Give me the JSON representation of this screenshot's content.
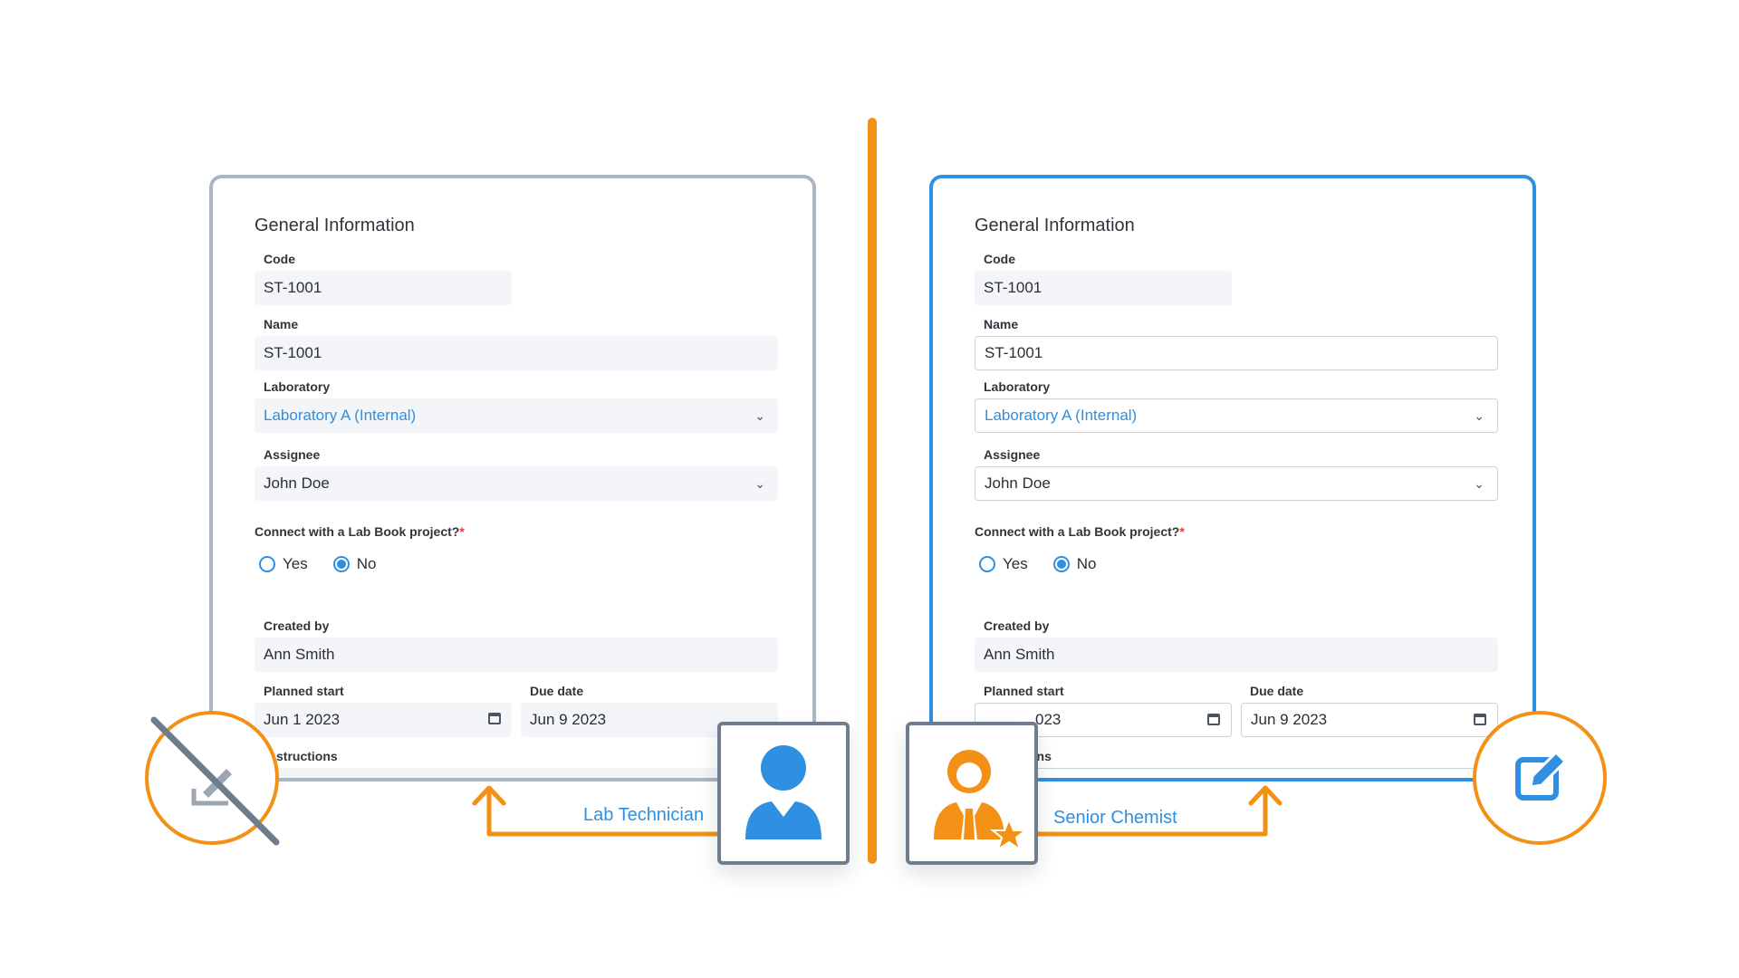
{
  "colors": {
    "accent_orange": "#f29115",
    "accent_blue": "#2f8fe0",
    "readonly_border": "#aab6c2",
    "icon_gray": "#6d7d8d"
  },
  "left_panel": {
    "role": "Lab Technician",
    "mode_icon": "edit-disabled-icon",
    "title": "General Information",
    "code_label": "Code",
    "code_value": "ST-1001",
    "name_label": "Name",
    "name_value": "ST-1001",
    "lab_label": "Laboratory",
    "lab_value": "Laboratory A (Internal)",
    "assignee_label": "Assignee",
    "assignee_value": "John Doe",
    "connect_label": "Connect with a Lab Book project?",
    "required_mark": "*",
    "yes_label": "Yes",
    "no_label": "No",
    "selected_option": "No",
    "created_label": "Created by",
    "created_value": "Ann Smith",
    "start_label": "Planned start",
    "start_value": "Jun 1 2023",
    "due_label": "Due date",
    "due_value": "Jun 9 2023",
    "instructions_label": "structions"
  },
  "right_panel": {
    "role": "Senior Chemist",
    "mode_icon": "edit-icon",
    "title": "General Information",
    "code_label": "Code",
    "code_value": "ST-1001",
    "name_label": "Name",
    "name_value": "ST-1001",
    "lab_label": "Laboratory",
    "lab_value": "Laboratory A (Internal)",
    "assignee_label": "Assignee",
    "assignee_value": "John Doe",
    "connect_label": "Connect with a Lab Book project?",
    "required_mark": "*",
    "yes_label": "Yes",
    "no_label": "No",
    "selected_option": "No",
    "created_label": "Created by",
    "created_value": "Ann Smith",
    "start_label": "Planned start",
    "start_value": "023",
    "due_label": "Due date",
    "due_value": "Jun 9 2023",
    "instructions_label": "ons"
  },
  "icons": {
    "left_role": "user-icon",
    "right_role": "user-star-icon",
    "chevron": "chevron-down-icon",
    "calendar": "calendar-icon"
  }
}
